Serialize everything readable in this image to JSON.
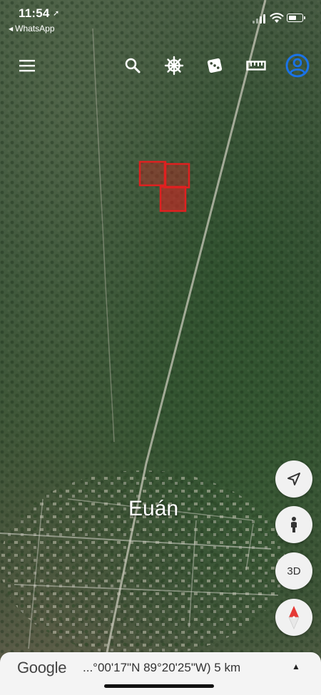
{
  "status_bar": {
    "time": "11:54",
    "location_glyph": "➚",
    "back_app_label": "WhatsApp"
  },
  "toolbar": {
    "menu_icon": "hamburger-menu-icon",
    "search_icon": "search-icon",
    "voyager_icon": "ship-wheel-icon",
    "feeling_lucky_icon": "dice-icon",
    "measure_icon": "ruler-icon",
    "account_icon": "account-icon"
  },
  "map": {
    "place_label": "Euán",
    "overlay_color": "#e02020"
  },
  "controls": {
    "locate_icon": "location-arrow-icon",
    "street_view_icon": "pegman-icon",
    "three_d_label": "3D",
    "compass_icon": "compass-icon"
  },
  "bottom_bar": {
    "logo": "Google",
    "coordinates": "...°00'17\"N 89°20'25\"W) 5 km",
    "expand_glyph": "▲"
  },
  "colors": {
    "account_blue": "#1a73e8",
    "compass_red": "#e53935"
  }
}
